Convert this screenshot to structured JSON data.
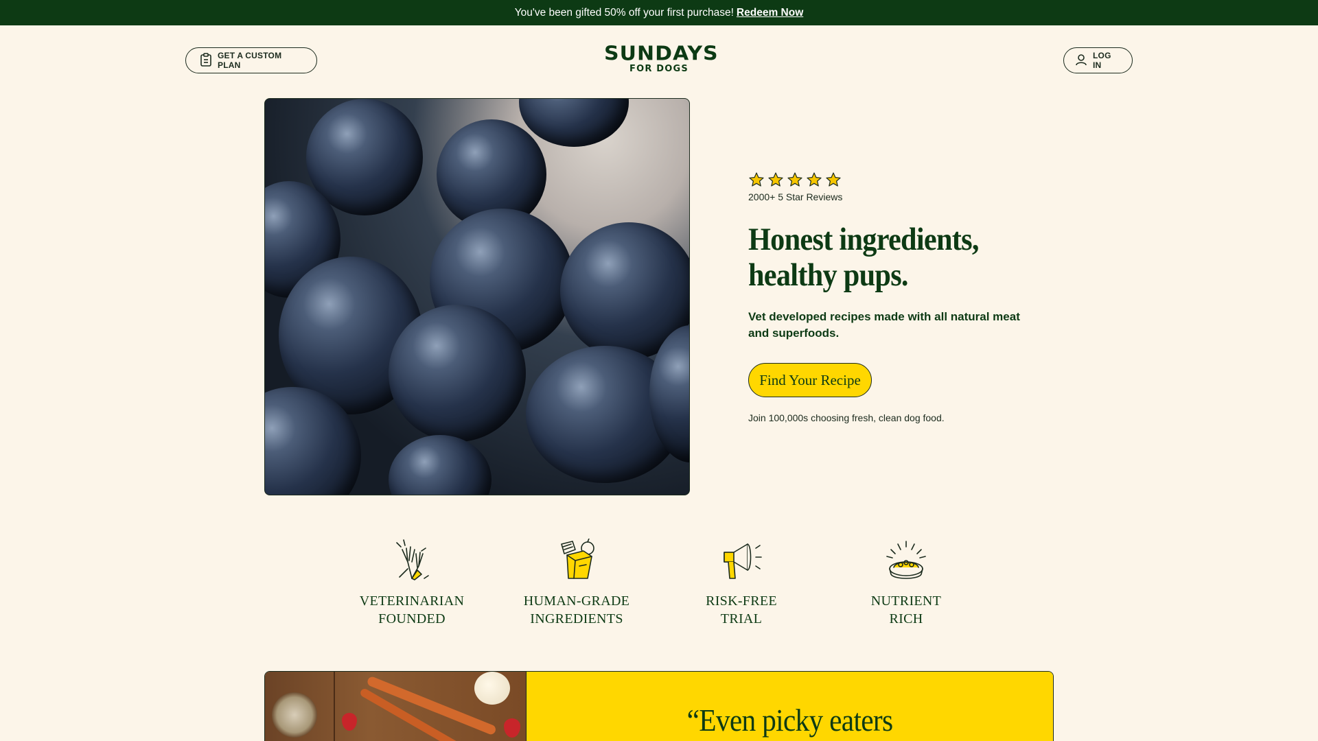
{
  "promo": {
    "text": "You've been gifted 50% off your first purchase!",
    "link": "Redeem Now"
  },
  "header": {
    "plan_button": "GET A CUSTOM PLAN",
    "logo_line1": "SUNDAYS",
    "logo_line2": "FOR DOGS",
    "login_button": "LOG IN"
  },
  "hero": {
    "rating_stars": 5,
    "reviews": "2000+ 5 Star Reviews",
    "headline_line1": "Honest ingredients,",
    "headline_line2": "healthy pups.",
    "subhead": "Vet developed recipes made with all natural meat and superfoods.",
    "cta": "Find Your Recipe",
    "join_text": "Join 100,000s choosing fresh, clean dog food."
  },
  "features": [
    {
      "icon": "high-five-icon",
      "line1": "VETERINARIAN",
      "line2": "FOUNDED"
    },
    {
      "icon": "ingredients-icon",
      "line1": "HUMAN-GRADE",
      "line2": "INGREDIENTS"
    },
    {
      "icon": "megaphone-icon",
      "line1": "RISK-FREE",
      "line2": "TRIAL"
    },
    {
      "icon": "food-bowl-icon",
      "line1": "NUTRIENT",
      "line2": "RICH"
    }
  ],
  "testimonial": {
    "quote": "“Even picky eaters"
  },
  "colors": {
    "background": "#fcf5e9",
    "brand_green": "#0d3a14",
    "accent_yellow": "#ffd700",
    "star_yellow": "#f7c600"
  }
}
